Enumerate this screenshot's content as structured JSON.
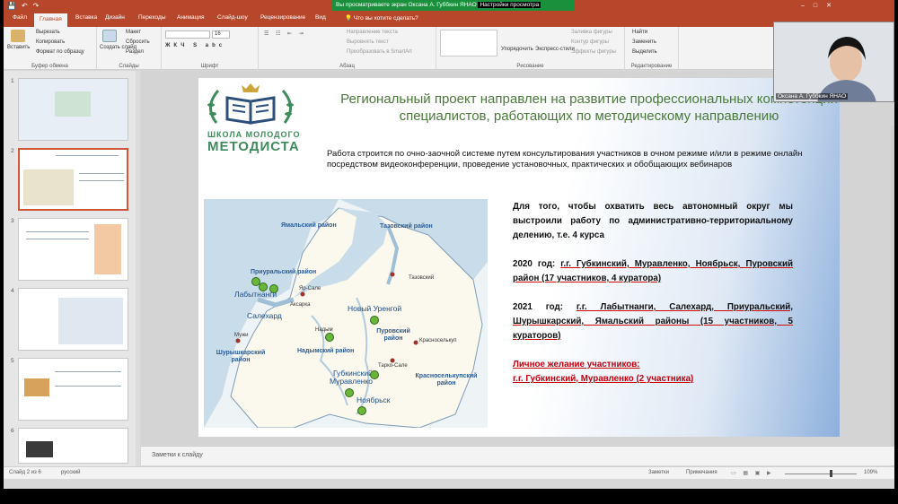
{
  "share_bar": {
    "text": "Вы просматриваете экран Оксана А. Губбкин ЯНАО",
    "settings": "Настройки просмотра"
  },
  "tabs": [
    "Файл",
    "Главная",
    "Вставка",
    "Дизайн",
    "Переходы",
    "Анимация",
    "Слайд-шоу",
    "Рецензирование",
    "Вид"
  ],
  "active_tab": "Главная",
  "tell_me": "Что вы хотите сделать?",
  "ribbon": {
    "clipboard": {
      "paste": "Вставить",
      "cut": "Вырезать",
      "copy": "Копировать",
      "format_painter": "Формат по образцу",
      "name": "Буфер обмена"
    },
    "slides": {
      "new_slide": "Создать слайд",
      "layout": "Макет",
      "reset": "Сбросить",
      "section": "Раздел",
      "name": "Слайды"
    },
    "font": {
      "name": "Шрифт",
      "size": "16"
    },
    "paragraph": {
      "text_direction": "Направление текста",
      "align_text": "Выровнять текст",
      "smartart": "Преобразовать в SmartArt",
      "name": "Абзац"
    },
    "drawing": {
      "arrange": "Упорядочить",
      "quick_styles": "Экспресс-стили",
      "fill": "Заливка фигуры",
      "outline": "Контур фигуры",
      "effects": "Эффекты фигуры",
      "name": "Рисование"
    },
    "editing": {
      "find": "Найти",
      "replace": "Заменить",
      "select": "Выделить",
      "name": "Редактирование"
    }
  },
  "slide": {
    "logo_line1": "ШКОЛА МОЛОДОГО",
    "logo_line2": "МЕТОДИСТА",
    "title": "Региональный проект направлен на развитие профессиональных компетенций специалистов, работающих по методическому направлению",
    "intro": "Работа строится по очно-заочной системе путем консультирования участников в очном режиме и/или в режиме онлайн посредством видеоконференции, проведение установочных, практических и обобщающих вебинаров",
    "fact1": "Для того, чтобы охватить весь автономный округ мы выстроили работу по административно-территориальному делению, т.е. 4 курса",
    "fact2_prefix": "2020 год:",
    "fact2_body": "г.г. Губкинский, Муравленко, Ноябрьск, Пуровский район (17 участников, 4 куратора)",
    "fact3_prefix": "2021 год:",
    "fact3_body": "г.г. Лабытнанги, Салехард, Приуральский, Шурышкарский, Ямальский районы (15 участников, 5 кураторов)",
    "wish_title": "Личное желание участников:",
    "wish_body": "г.г. Губкинский, Муравленко (2 участника)",
    "map_labels": {
      "yamal": "Ямальский район",
      "taz": "Тазовский район",
      "priural": "Приуральский район",
      "labytnangi": "Лабытнанги",
      "salekhard": "Салехард",
      "yar_sale": "Яр-Сале",
      "aksarka": "Аксарка",
      "tazovsky": "Тазовский",
      "novy_urengoy": "Новый Уренгой",
      "nadym": "Надым",
      "nadym_rayon": "Надымский район",
      "purovsky": "Пуровский район",
      "krasnoselkup": "Красноселькуп",
      "tarko_sale": "Тарко-Сале",
      "muzhi": "Мужи",
      "shuryshkar": "Шурышкарский район",
      "gubkinsky": "Губкинский",
      "muravlenko": "Муравленко",
      "noyabrsk": "Ноябрьск",
      "krasnoselkup_rayon": "Красноселькупский район"
    }
  },
  "thumbnails": [
    "1",
    "2",
    "3",
    "4",
    "5",
    "6"
  ],
  "notes_placeholder": "Заметки к слайду",
  "status": {
    "slide": "Слайд 2 из 6",
    "language": "русский",
    "notes": "Заметки",
    "comments": "Примечания",
    "zoom": "109%"
  },
  "webcam_name": "Оксана А. Губбкин ЯНАО",
  "colors": {
    "ribbon_accent": "#b7472a",
    "title_green": "#4a7a3a",
    "highlight_red": "#c0000f",
    "share_bar": "#1a8f3c"
  }
}
